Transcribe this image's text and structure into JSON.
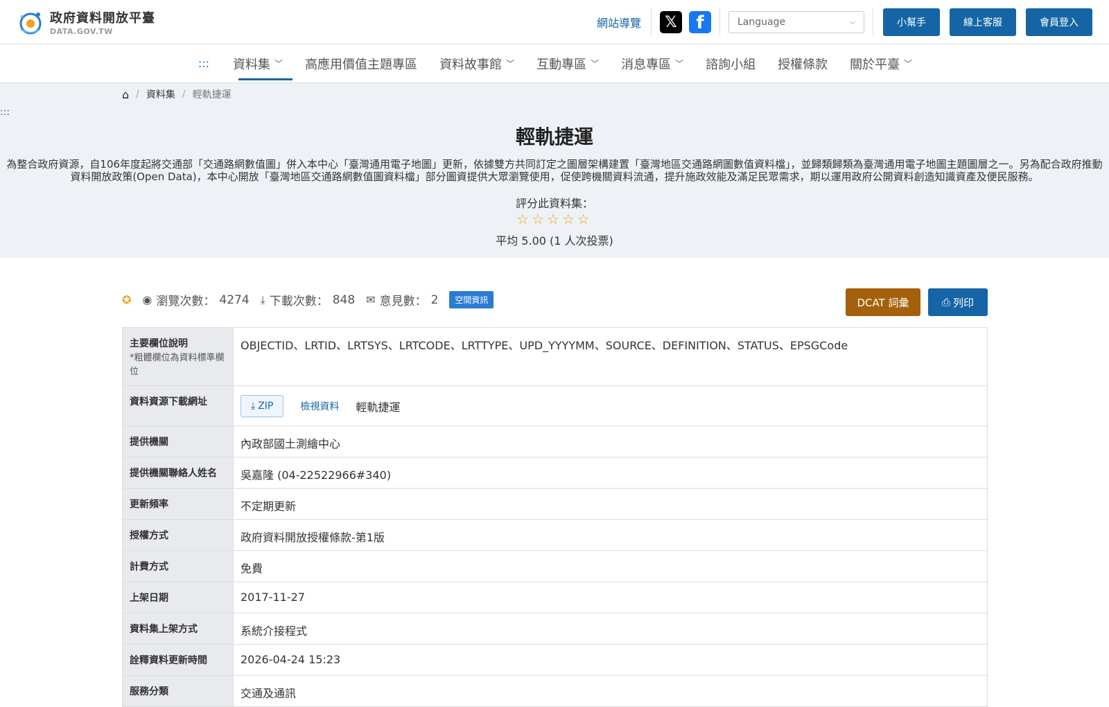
{
  "header": {
    "logo_title": "政府資料開放平臺",
    "logo_sub": "DATA.GOV.TW",
    "sitemap": "網站導覽",
    "language_placeholder": "Language",
    "helper_button": "小幫手",
    "service_button": "線上客服",
    "login_button": "會員登入"
  },
  "nav": {
    "access": ":::",
    "items": [
      "資料集",
      "高應用價值主題專區",
      "資料故事館",
      "互動專區",
      "消息專區",
      "諮詢小組",
      "授權條款",
      "關於平臺"
    ]
  },
  "breadcrumb": {
    "item1": "資料集",
    "item2": "輕軌捷運"
  },
  "hero": {
    "access": ":::",
    "title": "輕軌捷運",
    "description": "為整合政府資源，自106年度起將交通部「交通路網數值圖」併入本中心「臺灣通用電子地圖」更新，依據雙方共同訂定之圖層架構建置「臺灣地區交通路網圖數值資料檔」，並歸類歸類為臺灣通用電子地圖主題圖層之一。另為配合政府推動資料開放政策(Open Data)，本中心開放「臺灣地區交通路網數值圖資料檔」部分圖資提供大眾瀏覽使用，促使跨機關資料流通，提升施政效能及滿足民眾需求，期以運用政府公開資料創造知識資產及便民服務。",
    "rate_label": "評分此資料集：",
    "stars": "☆☆☆☆☆",
    "average": "平均 5.00 (1 人次投票)"
  },
  "stats": {
    "views_label": "瀏覽次數：",
    "views": "4274",
    "downloads_label": "下載次數：",
    "downloads": "848",
    "comments_label": "意見數：",
    "comments": "2",
    "tag": "空間資訊",
    "dcat_button": "DCAT 詞彙",
    "print_button": "列印"
  },
  "table": {
    "fields_key": "主要欄位說明",
    "fields_sub": "*粗體欄位為資料標準欄位",
    "fields_value": "OBJECTID、LRTID、LRTSYS、LRTCODE、LRTTYPE、UPD_YYYYMM、SOURCE、DEFINITION、STATUS、EPSGCode",
    "download_key": "資料資源下載網址",
    "zip_label": "ZIP",
    "view_label": "檢視資料",
    "resource_name": "輕軌捷運",
    "org_key": "提供機關",
    "org_value": "內政部國土測繪中心",
    "contact_key": "提供機關聯絡人姓名",
    "contact_value": "吳嘉隆 (04-22522966#340)",
    "freq_key": "更新頻率",
    "freq_value": "不定期更新",
    "license_key": "授權方式",
    "license_value": "政府資料開放授權條款-第1版",
    "fee_key": "計費方式",
    "fee_value": "免費",
    "date_key": "上架日期",
    "date_value": "2017-11-27",
    "method_key": "資料集上架方式",
    "method_value": "系統介接程式",
    "meta_key": "詮釋資料更新時間",
    "meta_value": "2026-04-24 15:23",
    "category_key": "服務分類",
    "category_value": "交通及通訊"
  }
}
